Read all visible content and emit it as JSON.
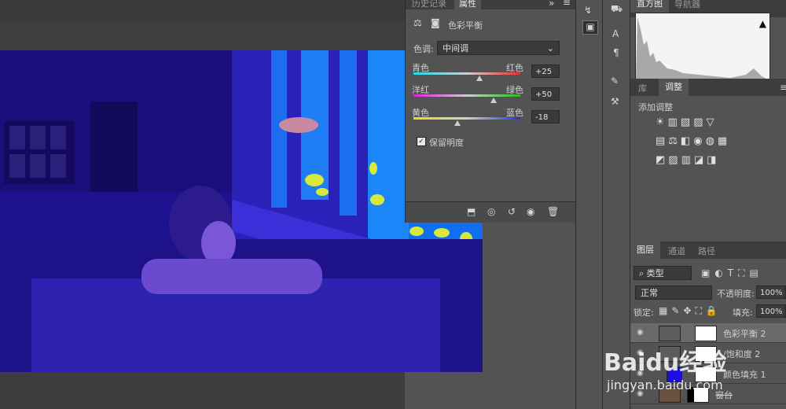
{
  "topbar": {},
  "properties": {
    "tabs": [
      "历史记录",
      "属性"
    ],
    "title": "色彩平衡",
    "tone_label": "色调:",
    "tone_value": "中间调",
    "sliders": [
      {
        "left": "青色",
        "right": "红色",
        "value": "+25",
        "knob": 0.62
      },
      {
        "left": "洋红",
        "right": "绿色",
        "value": "+50",
        "knob": 0.75
      },
      {
        "left": "黄色",
        "right": "蓝色",
        "value": "-18",
        "knob": 0.41
      }
    ],
    "preserve_luminosity": "保留明度"
  },
  "right": {
    "top_tabs": [
      "直方图",
      "导航器"
    ],
    "adj_tabs": [
      "库",
      "调整"
    ],
    "adj_title": "添加调整",
    "layers_tabs": [
      "图层",
      "通道",
      "路径"
    ],
    "filter_label": "类型",
    "blend_mode": "正常",
    "opacity_label": "不透明度:",
    "opacity_value": "100%",
    "lock_label": "锁定:",
    "fill_label": "填充:",
    "fill_value": "100%",
    "layers": [
      {
        "name": "色彩平衡 2"
      },
      {
        "name": "/饱和度 2"
      },
      {
        "name": "颜色填充 1"
      },
      {
        "name": "窗台"
      }
    ]
  },
  "watermark": {
    "brand": "Baidu经验",
    "url": "jingyan.baidu.com"
  },
  "colors": {
    "accent": "#1a0fc0",
    "panel": "#535353"
  }
}
